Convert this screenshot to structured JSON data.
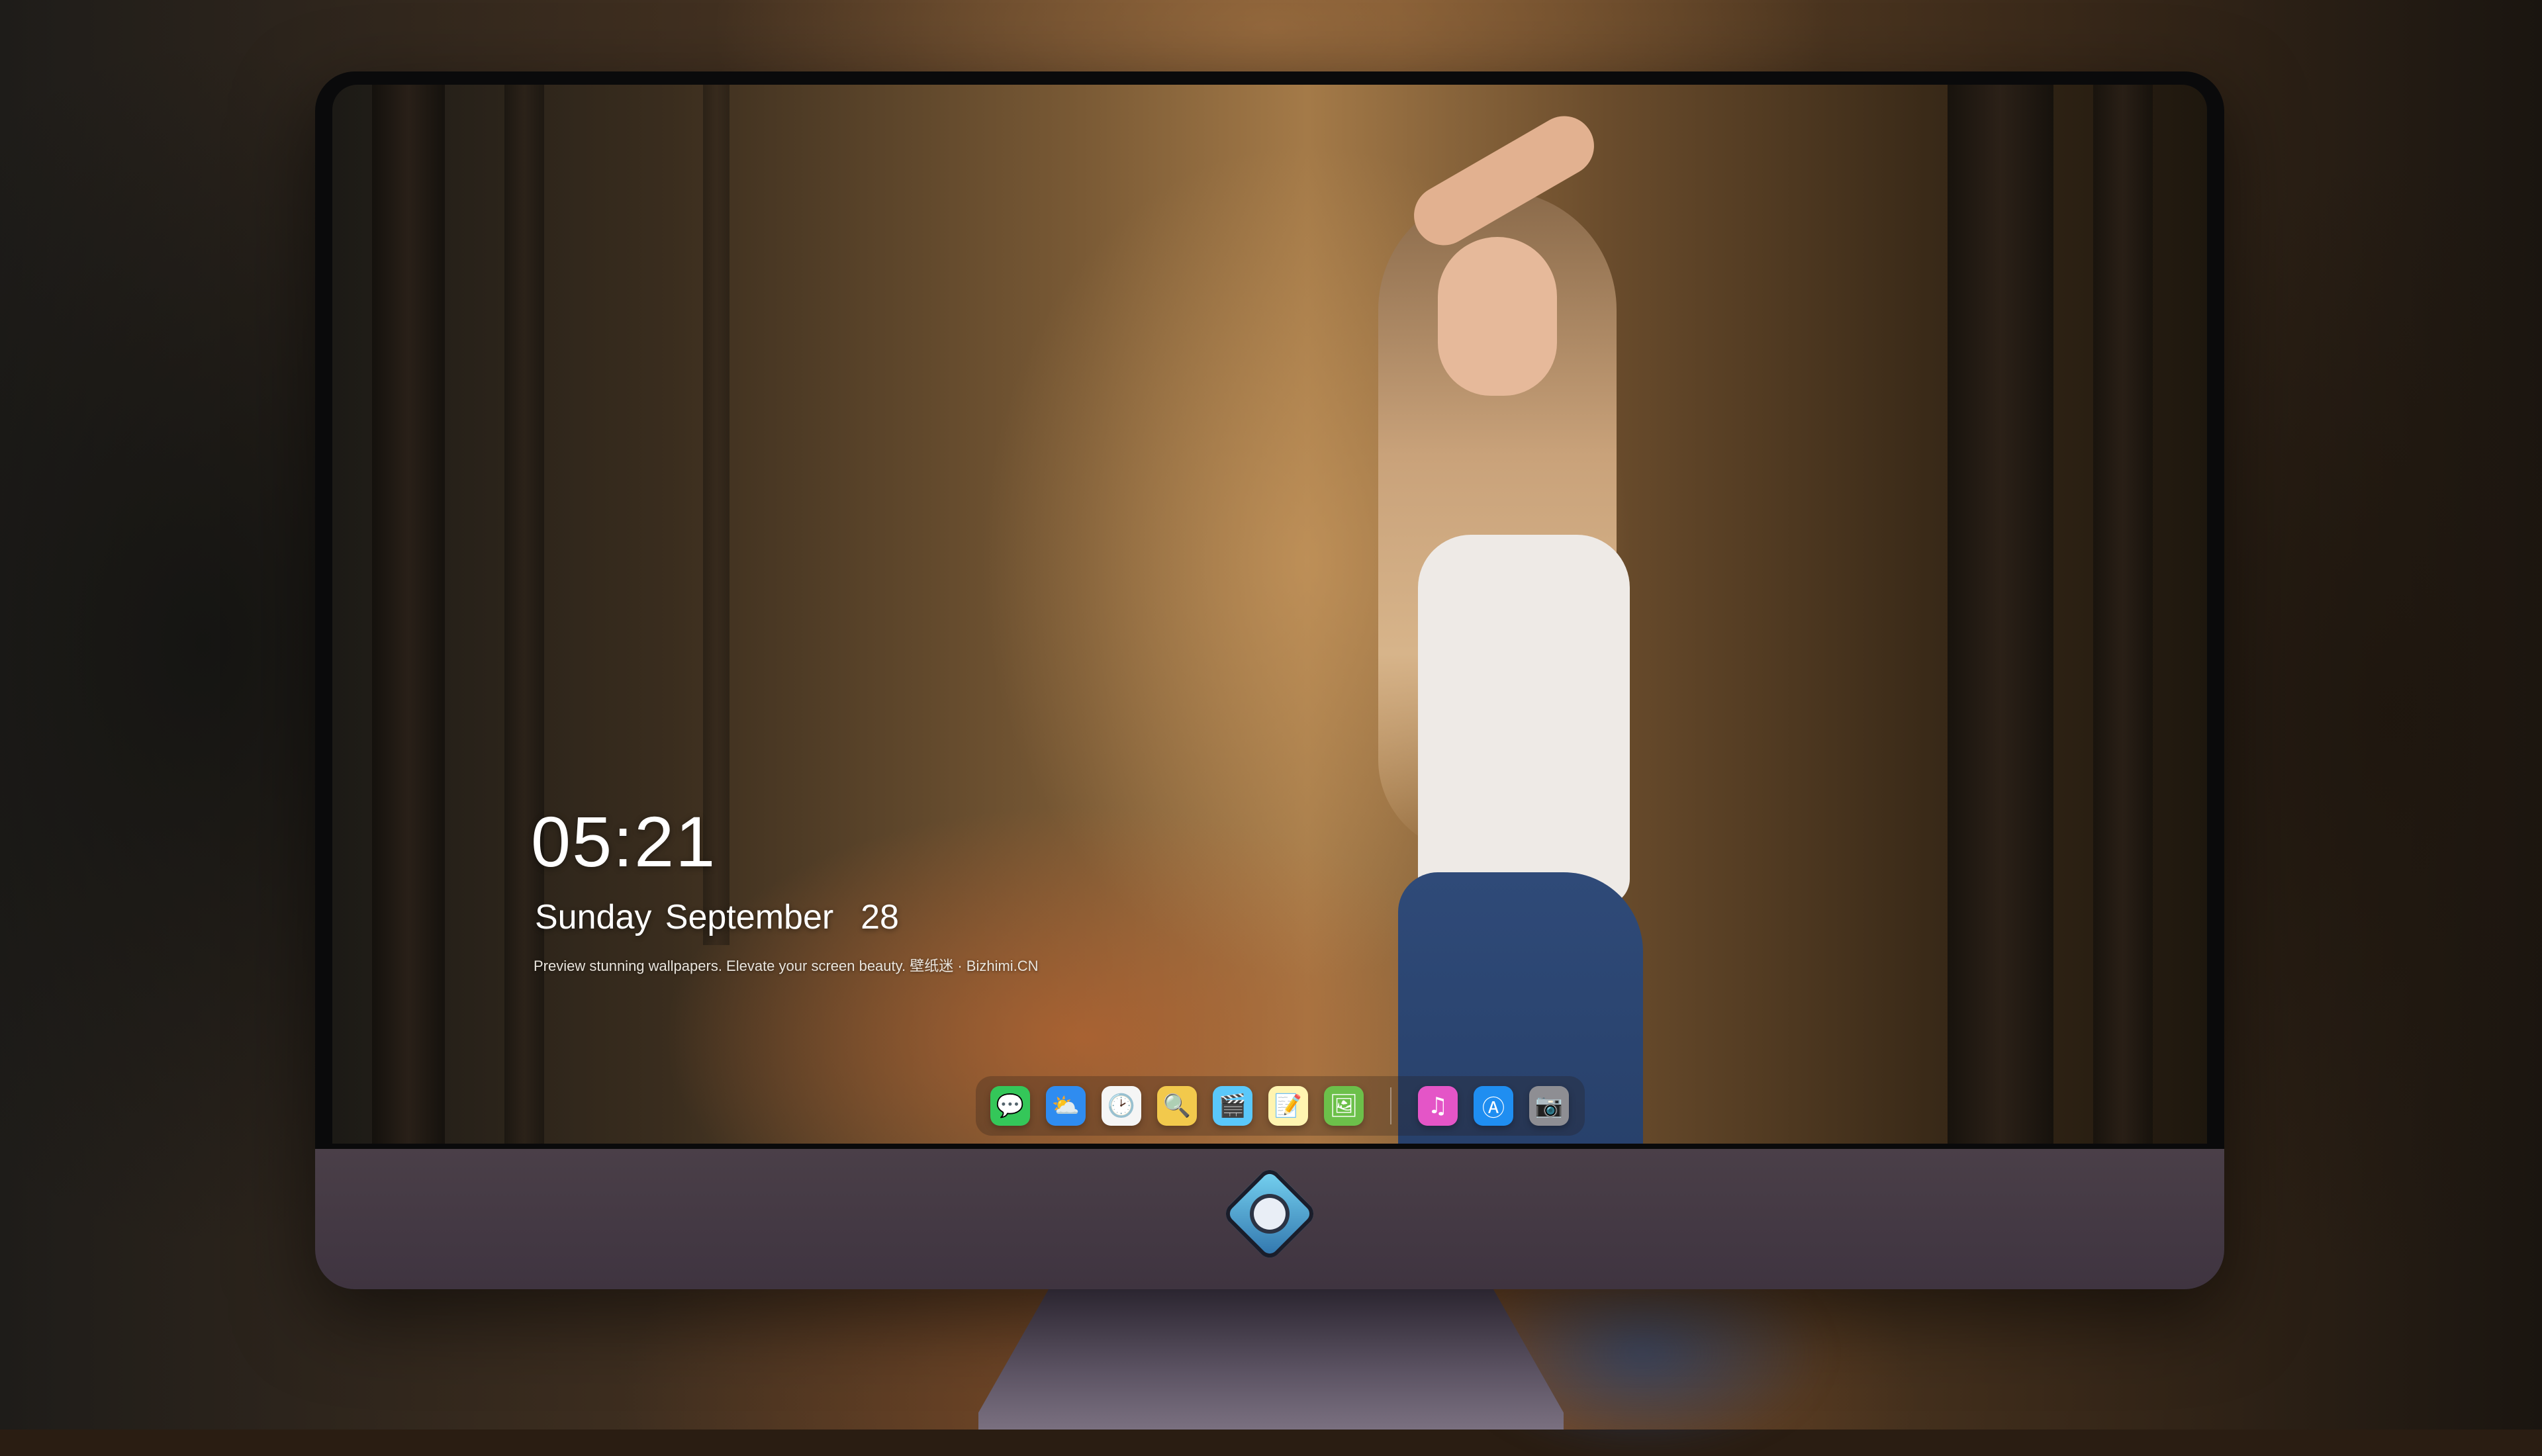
{
  "lockscreen": {
    "time": "05:21",
    "date": "Sunday September  28",
    "tagline": "Preview stunning wallpapers. Elevate your screen beauty. 壁纸迷 · Bizhimi.CN"
  },
  "dock": {
    "apps": [
      {
        "name": "messages-icon",
        "glyph": "💬",
        "color": "#34c759"
      },
      {
        "name": "weather-icon",
        "glyph": "⛅",
        "color": "#2f8cf0"
      },
      {
        "name": "clock-icon",
        "glyph": "🕑",
        "color": "#f5f5f5"
      },
      {
        "name": "preview-icon",
        "glyph": "🔍",
        "color": "#f2c94c"
      },
      {
        "name": "clips-icon",
        "glyph": "🎬",
        "color": "#5ac8fa"
      },
      {
        "name": "notes-icon",
        "glyph": "📝",
        "color": "#fff4b0"
      },
      {
        "name": "photo-booth-icon",
        "glyph": "🖼",
        "color": "#6cc04a"
      },
      {
        "name": "itunes-icon",
        "glyph": "♫",
        "color": "#e455c7"
      },
      {
        "name": "app-store-icon",
        "glyph": "Ⓐ",
        "color": "#1f8ef1"
      },
      {
        "name": "camera-icon",
        "glyph": "📷",
        "color": "#8e8e93"
      }
    ]
  },
  "colors": {
    "monitor_chin": "#4a3f48",
    "bezel": "#0a0a0b",
    "logo_accent": "#7ad8f5"
  }
}
